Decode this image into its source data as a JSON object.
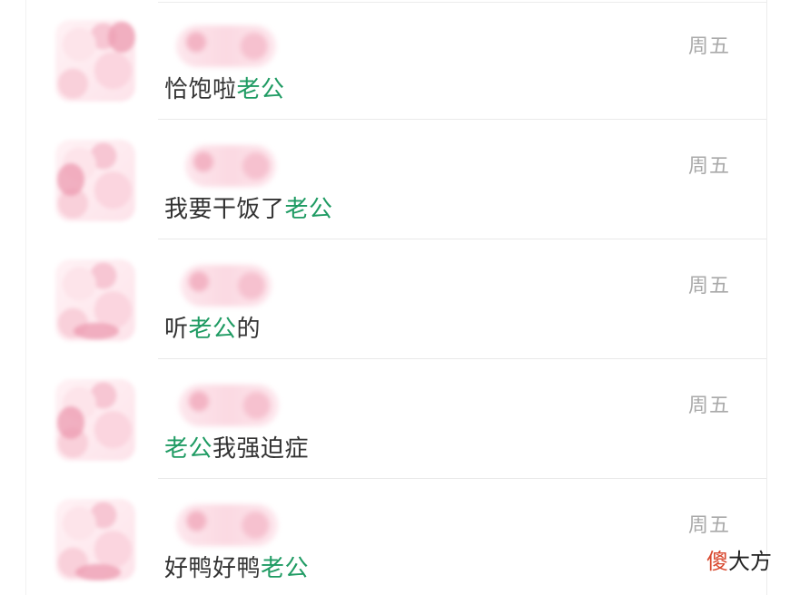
{
  "conversations": [
    {
      "time": "周五",
      "message_parts": [
        {
          "text": "恰饱啦",
          "highlight": false
        },
        {
          "text": "老公",
          "highlight": true
        }
      ]
    },
    {
      "time": "周五",
      "message_parts": [
        {
          "text": "我要干饭了",
          "highlight": false
        },
        {
          "text": "老公",
          "highlight": true
        }
      ]
    },
    {
      "time": "周五",
      "message_parts": [
        {
          "text": "听",
          "highlight": false
        },
        {
          "text": "老公",
          "highlight": true
        },
        {
          "text": "的",
          "highlight": false
        }
      ]
    },
    {
      "time": "周五",
      "message_parts": [
        {
          "text": "老公",
          "highlight": true
        },
        {
          "text": "我强迫症",
          "highlight": false
        }
      ]
    },
    {
      "time": "周五",
      "message_parts": [
        {
          "text": "好鸭好鸭",
          "highlight": false
        },
        {
          "text": "老公",
          "highlight": true
        }
      ]
    }
  ],
  "watermark": {
    "red_part": "傻",
    "dark_part": "大方"
  },
  "colors": {
    "highlight": "#1f9b63",
    "message_text": "#333333",
    "time_text": "#a9a9a9",
    "watermark_red": "#d8482e"
  }
}
